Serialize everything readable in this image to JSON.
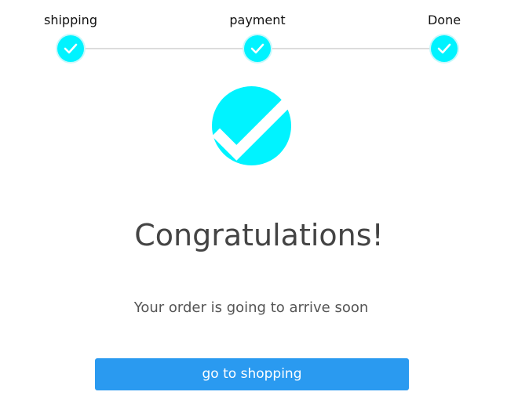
{
  "stepper": {
    "steps": [
      {
        "label": "shipping",
        "state": "complete"
      },
      {
        "label": "payment",
        "state": "complete"
      },
      {
        "label": "Done",
        "state": "complete"
      }
    ],
    "accent_color": "#00f3ff",
    "line_color": "#dcdcdc",
    "icon": "check-icon"
  },
  "success": {
    "icon": "large-check-icon",
    "title": "Congratulations!",
    "message": "Your order is going to arrive soon"
  },
  "actions": {
    "primary_label": "go to shopping",
    "primary_color": "#2a9af0"
  }
}
